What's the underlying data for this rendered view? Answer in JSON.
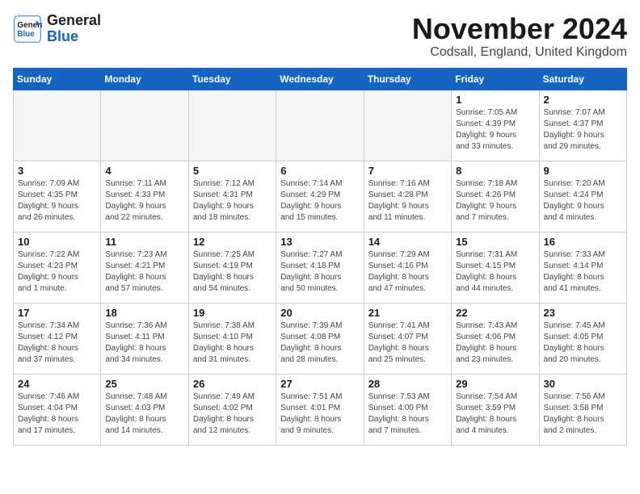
{
  "header": {
    "logo_line1": "General",
    "logo_line2": "Blue",
    "month": "November 2024",
    "location": "Codsall, England, United Kingdom"
  },
  "weekdays": [
    "Sunday",
    "Monday",
    "Tuesday",
    "Wednesday",
    "Thursday",
    "Friday",
    "Saturday"
  ],
  "weeks": [
    [
      {
        "day": "",
        "text": ""
      },
      {
        "day": "",
        "text": ""
      },
      {
        "day": "",
        "text": ""
      },
      {
        "day": "",
        "text": ""
      },
      {
        "day": "",
        "text": ""
      },
      {
        "day": "1",
        "text": "Sunrise: 7:05 AM\nSunset: 4:39 PM\nDaylight: 9 hours\nand 33 minutes."
      },
      {
        "day": "2",
        "text": "Sunrise: 7:07 AM\nSunset: 4:37 PM\nDaylight: 9 hours\nand 29 minutes."
      }
    ],
    [
      {
        "day": "3",
        "text": "Sunrise: 7:09 AM\nSunset: 4:35 PM\nDaylight: 9 hours\nand 26 minutes."
      },
      {
        "day": "4",
        "text": "Sunrise: 7:11 AM\nSunset: 4:33 PM\nDaylight: 9 hours\nand 22 minutes."
      },
      {
        "day": "5",
        "text": "Sunrise: 7:12 AM\nSunset: 4:31 PM\nDaylight: 9 hours\nand 18 minutes."
      },
      {
        "day": "6",
        "text": "Sunrise: 7:14 AM\nSunset: 4:29 PM\nDaylight: 9 hours\nand 15 minutes."
      },
      {
        "day": "7",
        "text": "Sunrise: 7:16 AM\nSunset: 4:28 PM\nDaylight: 9 hours\nand 11 minutes."
      },
      {
        "day": "8",
        "text": "Sunrise: 7:18 AM\nSunset: 4:26 PM\nDaylight: 9 hours\nand 7 minutes."
      },
      {
        "day": "9",
        "text": "Sunrise: 7:20 AM\nSunset: 4:24 PM\nDaylight: 9 hours\nand 4 minutes."
      }
    ],
    [
      {
        "day": "10",
        "text": "Sunrise: 7:22 AM\nSunset: 4:23 PM\nDaylight: 9 hours\nand 1 minute."
      },
      {
        "day": "11",
        "text": "Sunrise: 7:23 AM\nSunset: 4:21 PM\nDaylight: 8 hours\nand 57 minutes."
      },
      {
        "day": "12",
        "text": "Sunrise: 7:25 AM\nSunset: 4:19 PM\nDaylight: 8 hours\nand 54 minutes."
      },
      {
        "day": "13",
        "text": "Sunrise: 7:27 AM\nSunset: 4:18 PM\nDaylight: 8 hours\nand 50 minutes."
      },
      {
        "day": "14",
        "text": "Sunrise: 7:29 AM\nSunset: 4:16 PM\nDaylight: 8 hours\nand 47 minutes."
      },
      {
        "day": "15",
        "text": "Sunrise: 7:31 AM\nSunset: 4:15 PM\nDaylight: 8 hours\nand 44 minutes."
      },
      {
        "day": "16",
        "text": "Sunrise: 7:33 AM\nSunset: 4:14 PM\nDaylight: 8 hours\nand 41 minutes."
      }
    ],
    [
      {
        "day": "17",
        "text": "Sunrise: 7:34 AM\nSunset: 4:12 PM\nDaylight: 8 hours\nand 37 minutes."
      },
      {
        "day": "18",
        "text": "Sunrise: 7:36 AM\nSunset: 4:11 PM\nDaylight: 8 hours\nand 34 minutes."
      },
      {
        "day": "19",
        "text": "Sunrise: 7:38 AM\nSunset: 4:10 PM\nDaylight: 8 hours\nand 31 minutes."
      },
      {
        "day": "20",
        "text": "Sunrise: 7:39 AM\nSunset: 4:08 PM\nDaylight: 8 hours\nand 28 minutes."
      },
      {
        "day": "21",
        "text": "Sunrise: 7:41 AM\nSunset: 4:07 PM\nDaylight: 8 hours\nand 25 minutes."
      },
      {
        "day": "22",
        "text": "Sunrise: 7:43 AM\nSunset: 4:06 PM\nDaylight: 8 hours\nand 23 minutes."
      },
      {
        "day": "23",
        "text": "Sunrise: 7:45 AM\nSunset: 4:05 PM\nDaylight: 8 hours\nand 20 minutes."
      }
    ],
    [
      {
        "day": "24",
        "text": "Sunrise: 7:46 AM\nSunset: 4:04 PM\nDaylight: 8 hours\nand 17 minutes."
      },
      {
        "day": "25",
        "text": "Sunrise: 7:48 AM\nSunset: 4:03 PM\nDaylight: 8 hours\nand 14 minutes."
      },
      {
        "day": "26",
        "text": "Sunrise: 7:49 AM\nSunset: 4:02 PM\nDaylight: 8 hours\nand 12 minutes."
      },
      {
        "day": "27",
        "text": "Sunrise: 7:51 AM\nSunset: 4:01 PM\nDaylight: 8 hours\nand 9 minutes."
      },
      {
        "day": "28",
        "text": "Sunrise: 7:53 AM\nSunset: 4:00 PM\nDaylight: 8 hours\nand 7 minutes."
      },
      {
        "day": "29",
        "text": "Sunrise: 7:54 AM\nSunset: 3:59 PM\nDaylight: 8 hours\nand 4 minutes."
      },
      {
        "day": "30",
        "text": "Sunrise: 7:56 AM\nSunset: 3:58 PM\nDaylight: 8 hours\nand 2 minutes."
      }
    ]
  ]
}
